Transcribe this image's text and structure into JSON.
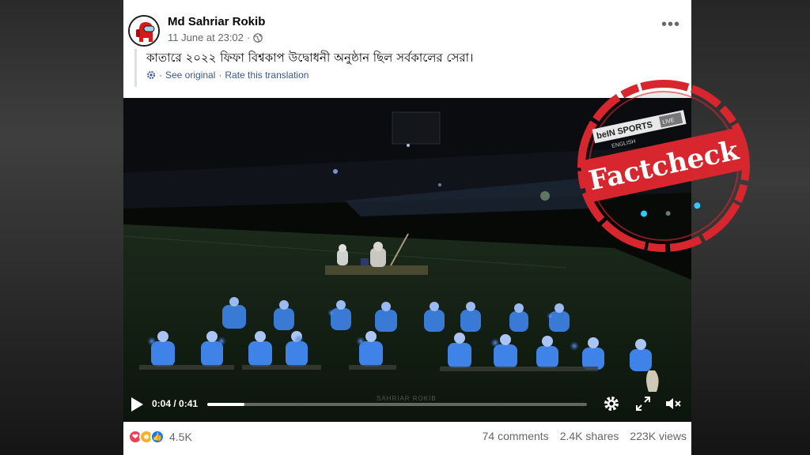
{
  "post": {
    "author": "Md Sahriar Rokib",
    "timestamp": "11 June at 23:02",
    "privacy_icon": "globe-icon",
    "caption": "কাতারে ২০২২ ফিফা বিশ্বকাপ উদ্বোধনী অনুষ্ঠান ছিল সর্বকালের সেরা।",
    "translation": {
      "see_original": "See original",
      "separator": "·",
      "rate": "Rate this translation"
    }
  },
  "video": {
    "time_display": "0:04 / 0:41",
    "progress_fraction": 0.098,
    "watermark": "SAHRIAR ROKIB",
    "broadcaster": {
      "brand": "beIN SPORTS",
      "tag": "LIVE",
      "sub": "ENGLISH"
    }
  },
  "engagement": {
    "reaction_count": "4.5K",
    "comments": "74 comments",
    "shares": "2.4K shares",
    "views": "223K views"
  },
  "stamp": {
    "text": "Factcheck",
    "color": "#d7262d"
  },
  "colors": {
    "link": "#385898",
    "secondary_text": "#65676b",
    "love": "#f33e58",
    "haha": "#f7b125",
    "like": "#1877f2"
  }
}
